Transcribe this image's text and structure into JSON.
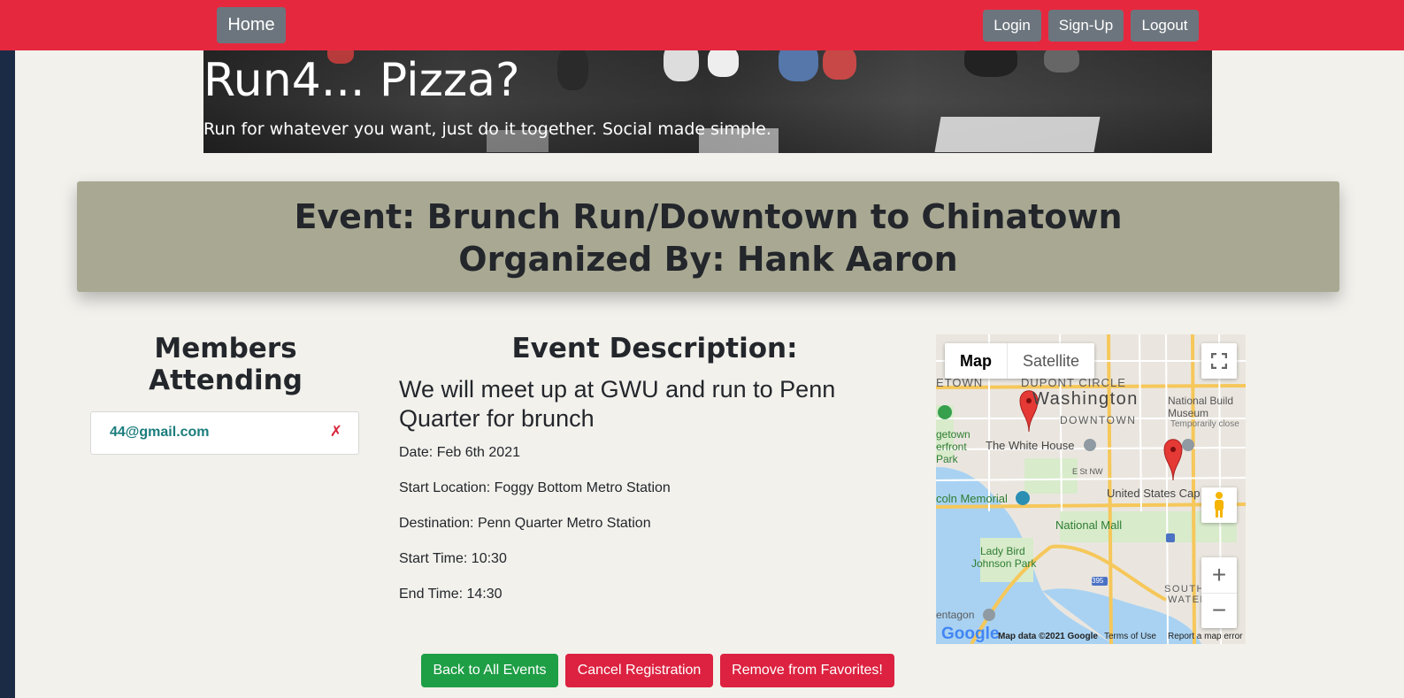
{
  "navbar": {
    "home_label": "Home",
    "login_label": "Login",
    "signup_label": "Sign-Up",
    "logout_label": "Logout"
  },
  "hero": {
    "title": "Run4... Pizza?",
    "subtitle": "Run for whatever you want, just do it together. Social made simple."
  },
  "event": {
    "title_line": "Event: Brunch Run/Downtown to Chinatown",
    "organizer_line": "Organized By: Hank Aaron"
  },
  "members": {
    "heading": "Members Attending",
    "items": [
      {
        "email": "44@gmail.com",
        "remove_icon": "✗"
      }
    ]
  },
  "description": {
    "heading": "Event Description:",
    "text": "We will meet up at GWU and run to Penn Quarter for brunch",
    "date": "Date: Feb 6th 2021",
    "start_location": "Start Location: Foggy Bottom Metro Station",
    "destination": "Destination: Penn Quarter Metro Station",
    "start_time": "Start Time: 10:30",
    "end_time": "End Time: 14:30"
  },
  "map": {
    "type_map": "Map",
    "type_satellite": "Satellite",
    "labels": {
      "washington": "Washington",
      "dupont": "DUPONT CIRCLE",
      "downtown": "DOWNTOWN",
      "georgetown": "ETOWN",
      "white_house": "The White House",
      "getown": "getown",
      "erfront": "erfront",
      "park": "Park",
      "lincoln": "coln Memorial",
      "national_mall": "National Mall",
      "capitol": "United States Cap",
      "lady_bird": "Lady Bird",
      "johnson_park": "Johnson Park",
      "national_build": "National Build",
      "museum": "Museum",
      "temp_closed": "Temporarily close",
      "southw": "SOUTHW",
      "waterf": "WATERF",
      "entagon": "entagon",
      "e_st": "E St NW",
      "i395": "395"
    },
    "footer_data": "Map data ©2021 Google",
    "footer_terms": "Terms of Use",
    "footer_report": "Report a map error",
    "logo": "Google",
    "zoom_in": "+",
    "zoom_out": "−"
  },
  "actions": {
    "back_label": "Back to All Events",
    "cancel_label": "Cancel Registration",
    "favorite_label": "Remove from Favorites!"
  },
  "colors": {
    "navbar": "#e6283f",
    "nav_button": "#6c757d",
    "event_box": "#a9a993",
    "page_bg": "#f2f1ec",
    "success": "#1e9e45",
    "danger": "#dc2240",
    "member_email": "#1b7c7c"
  }
}
